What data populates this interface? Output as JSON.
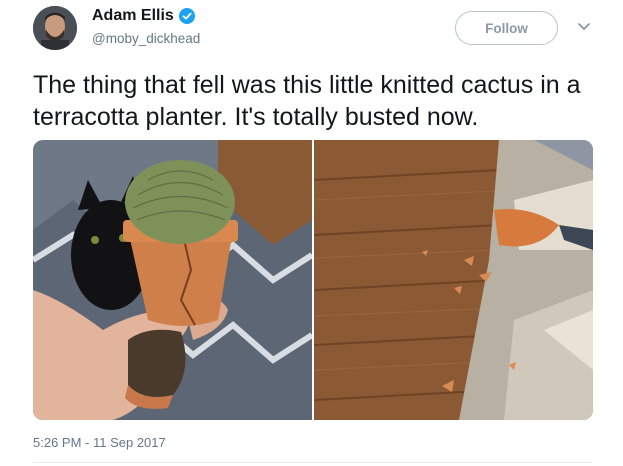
{
  "author": {
    "display_name": "Adam Ellis",
    "handle": "@moby_dickhead",
    "verified": true
  },
  "actions": {
    "follow_label": "Follow",
    "menu_icon": "chevron-down-icon"
  },
  "tweet": {
    "text": "The thing that fell was this little knitted cactus in a terracotta planter. It's totally busted now.",
    "timestamp": "5:26 PM - 11 Sep 2017"
  },
  "colors": {
    "verified_blue": "#1da1f2",
    "text": "#14171a",
    "secondary": "#657786",
    "follow_border": "#b8c3cc"
  }
}
